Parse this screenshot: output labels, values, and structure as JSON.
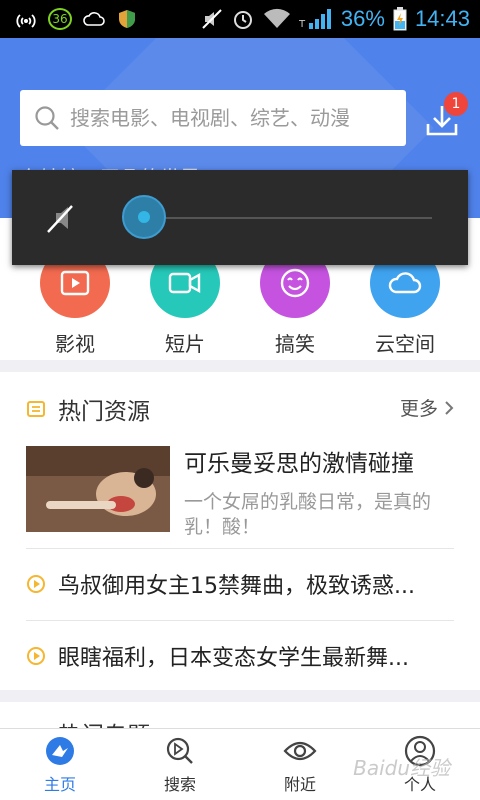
{
  "status_bar": {
    "badge": "36",
    "battery_pct": "36%",
    "time": "14:43"
  },
  "search": {
    "placeholder": "搜索电影、电视剧、综艺、动漫"
  },
  "download": {
    "badge": "1",
    "icon": "download-icon"
  },
  "tagline": "东妹娘，平凡的世界",
  "volume_overlay": {
    "muted": true,
    "level": 0
  },
  "categories": [
    {
      "label": "影视",
      "color": "#f26a4f",
      "icon": "play-icon"
    },
    {
      "label": "短片",
      "color": "#26c9b9",
      "icon": "video-camera-icon"
    },
    {
      "label": "搞笑",
      "color": "#c553e0",
      "icon": "smiley-icon"
    },
    {
      "label": "云空间",
      "color": "#3fa3f0",
      "icon": "cloud-icon"
    }
  ],
  "hot": {
    "title": "热门资源",
    "more": "更多",
    "feature": {
      "title": "可乐曼妥思的激情碰撞",
      "desc": "一个女屌的乳酸日常，是真的乳！酸！"
    },
    "items": [
      "鸟叔御用女主15禁舞曲，极致诱惑...",
      "眼瞎福利，日本变态女学生最新舞..."
    ]
  },
  "section2": {
    "title": "热门专题"
  },
  "nav": [
    {
      "label": "主页",
      "active": true
    },
    {
      "label": "搜索",
      "active": false
    },
    {
      "label": "附近",
      "active": false
    },
    {
      "label": "个人",
      "active": false
    }
  ],
  "watermark": "Baidu经验",
  "colors": {
    "accent": "#4f82ea",
    "active_nav": "#2f7be6",
    "badge": "#f0453a",
    "status_text": "#42b4f4"
  }
}
